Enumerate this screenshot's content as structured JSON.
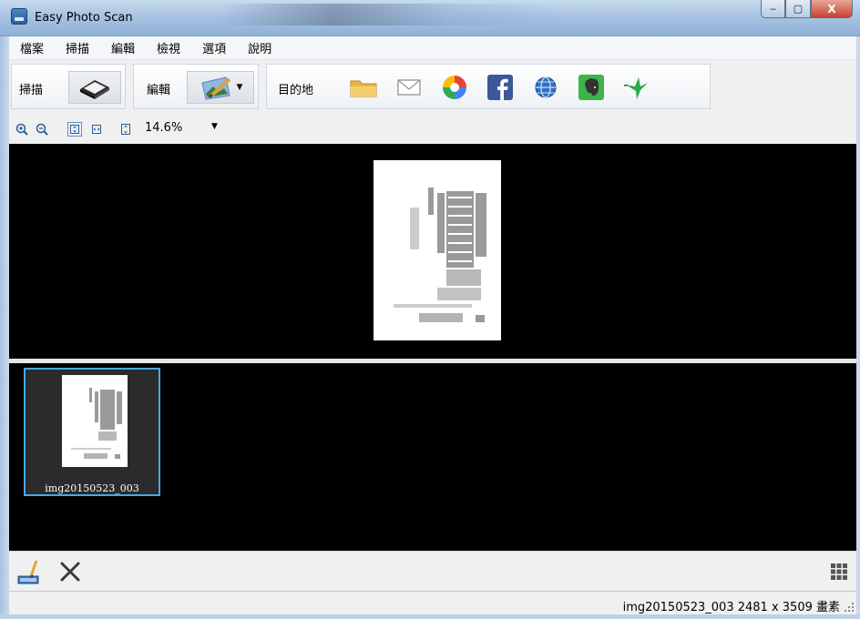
{
  "window": {
    "title": "Easy Photo Scan",
    "buttons": {
      "minimize": "‒",
      "maximize": "▢",
      "close": "X"
    }
  },
  "menu": [
    "檔案",
    "掃描",
    "編輯",
    "檢視",
    "選項",
    "說明"
  ],
  "toolbar": {
    "scan_label": "掃描",
    "edit_label": "編輯",
    "destination_label": "目的地",
    "destinations": [
      "folder-icon",
      "email-icon",
      "google-photos-icon",
      "facebook-icon",
      "web-globe-icon",
      "evernote-icon",
      "hummingbird-icon"
    ]
  },
  "zoom": {
    "value": "14.6%",
    "dropdown_glyph": "▼"
  },
  "thumbnails": [
    {
      "label": "img20150523_003",
      "selected": true
    }
  ],
  "status": {
    "text": "img20150523_003 2481 x 3509 畫素"
  },
  "colors": {
    "selection_border": "#4aa7e3",
    "canvas_background": "#000000",
    "facebook_blue": "#3b5998",
    "evernote_green": "#3db34a"
  }
}
